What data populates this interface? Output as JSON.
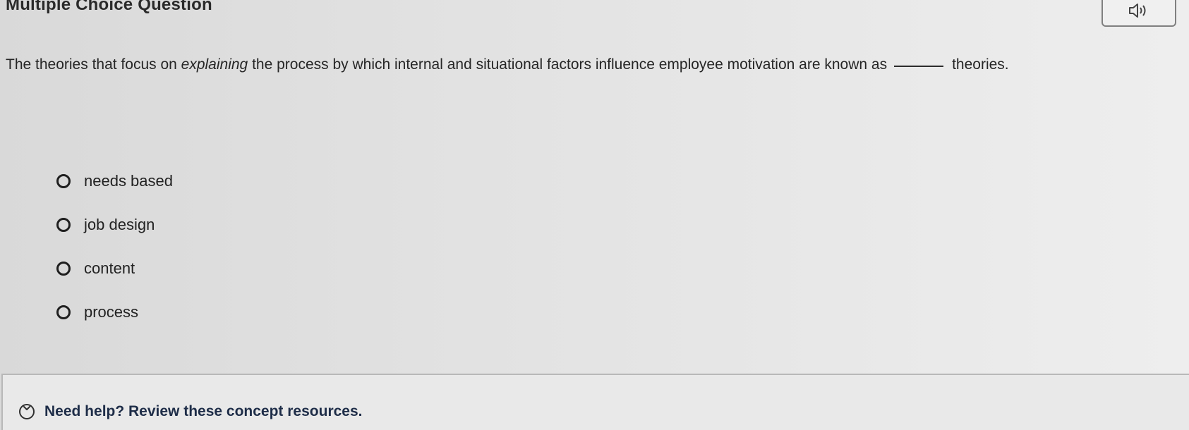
{
  "header": {
    "title": "Multiple Choice Question"
  },
  "question": {
    "part1": "The theories that focus on ",
    "emphasis": "explaining",
    "part2": " the process by which internal and situational factors influence employee motivation are known as",
    "part3": "theories."
  },
  "options": [
    {
      "label": "needs based",
      "selected": false
    },
    {
      "label": "job design",
      "selected": false
    },
    {
      "label": "content",
      "selected": false
    },
    {
      "label": "process",
      "selected": false
    }
  ],
  "help": {
    "label": "Need help? Review these concept resources."
  },
  "icons": {
    "audio": "speaker-icon",
    "help_toggle": "chevron-down-icon",
    "radio": "radio-icon"
  },
  "colors": {
    "text": "#262626",
    "help_link": "#1e2d48",
    "border": "#808080"
  }
}
